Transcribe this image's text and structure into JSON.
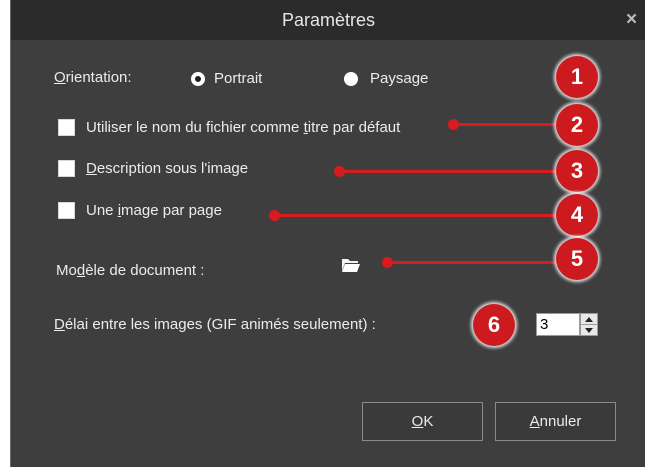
{
  "dialog": {
    "title": "Paramètres",
    "close_glyph": "×"
  },
  "orientation": {
    "label_hotkey": "O",
    "label_rest": "rientation:",
    "options": [
      {
        "label": "Portrait",
        "checked": true
      },
      {
        "label": "Paysage",
        "checked": false
      }
    ]
  },
  "options": {
    "use_filename_pre": "Utiliser le nom du fichier comme ",
    "use_filename_hotkey": "t",
    "use_filename_post": "itre par défaut",
    "description_hotkey": "D",
    "description_rest": "escription sous l'image",
    "one_image_pre": "Une ",
    "one_image_hotkey": "i",
    "one_image_post": "mage par page"
  },
  "template": {
    "label_pre": "Mo",
    "label_hotkey": "d",
    "label_post": "èle de document :",
    "icon": "folder-open-icon"
  },
  "delay": {
    "label_hotkey": "D",
    "label_rest": "élai entre les images (GIF animés seulement) :",
    "value": "3"
  },
  "buttons": {
    "ok_hotkey": "O",
    "ok_rest": "K",
    "cancel_hotkey": "A",
    "cancel_rest": "nnuler"
  },
  "callouts": [
    "1",
    "2",
    "3",
    "4",
    "5",
    "6"
  ],
  "colors": {
    "dialog_bg": "#3e3e3e",
    "titlebar_bg": "#2b2b2b",
    "callout_red": "#cc1a1e"
  }
}
